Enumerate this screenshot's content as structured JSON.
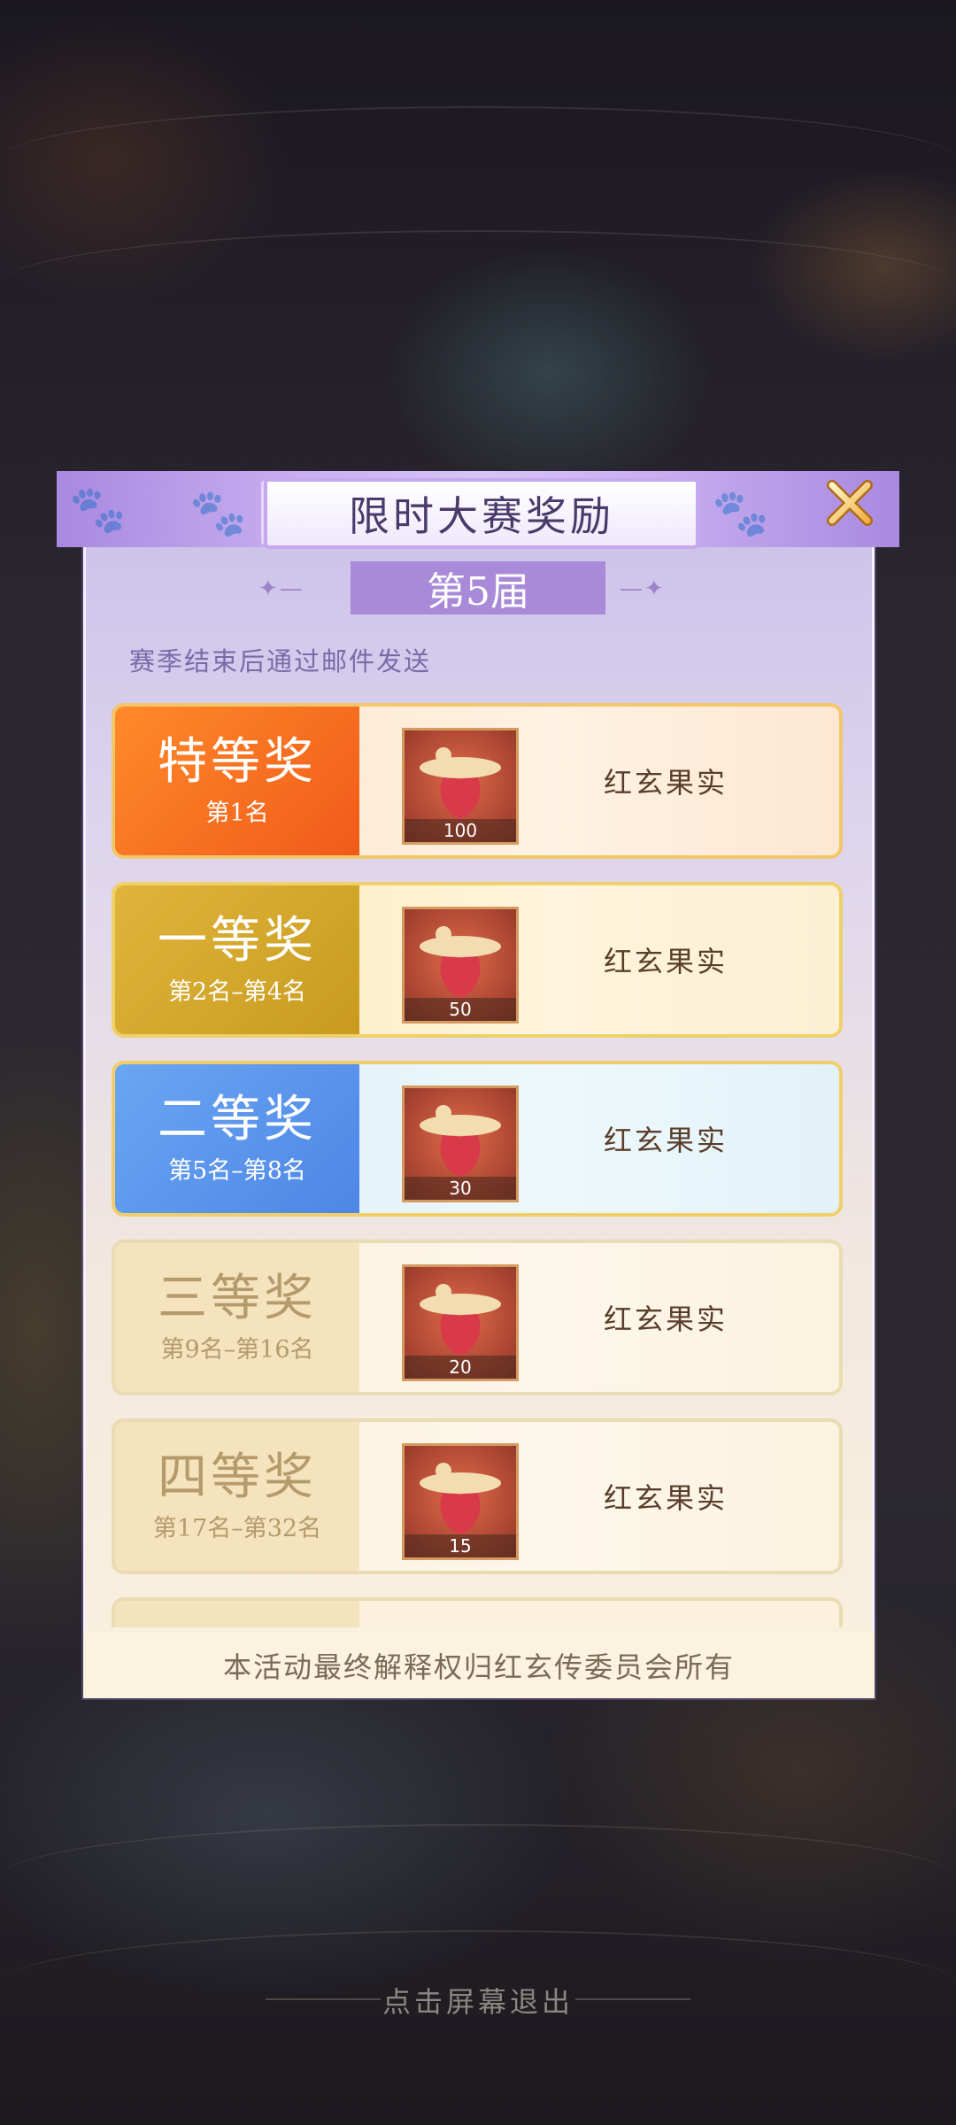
{
  "dialog": {
    "title": "限时大赛奖励",
    "season": "第5届",
    "subtitle": "赛季结束后通过邮件发送",
    "footer_note": "本活动最终解释权归红玄传委员会所有"
  },
  "rewards": [
    {
      "tier": "特等奖",
      "range": "第1名",
      "item_name": "红玄果实",
      "count": "100",
      "color": "#f06a22"
    },
    {
      "tier": "一等奖",
      "range": "第2名–第4名",
      "item_name": "红玄果实",
      "count": "50",
      "color": "#d4a62e"
    },
    {
      "tier": "二等奖",
      "range": "第5名–第8名",
      "item_name": "红玄果实",
      "count": "30",
      "color": "#5a94ec"
    },
    {
      "tier": "三等奖",
      "range": "第9名–第16名",
      "item_name": "红玄果实",
      "count": "20",
      "color": "#f4e3bd"
    },
    {
      "tier": "四等奖",
      "range": "第17名–第32名",
      "item_name": "红玄果实",
      "count": "15",
      "color": "#f4e3bd"
    }
  ],
  "exit_hint": "点击屏幕退出",
  "icons": {
    "close": "close-icon",
    "item": "red-fruit-icon",
    "paw": "paw-icon"
  }
}
